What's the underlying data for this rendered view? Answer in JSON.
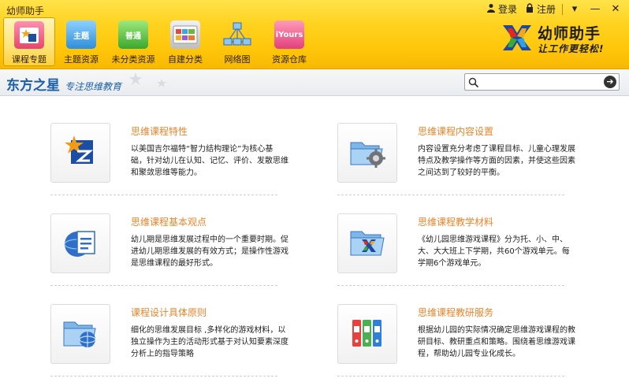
{
  "window": {
    "title": "幼师助手",
    "login": "登录",
    "register": "注册",
    "controls": {
      "menu": "▾",
      "minimize": "—",
      "close": "✕"
    }
  },
  "toolbar": {
    "items": [
      {
        "id": "topic",
        "label": "课程专题",
        "badge": "",
        "active": true
      },
      {
        "id": "theme",
        "label": "主题资源",
        "badge": "主题",
        "active": false
      },
      {
        "id": "general",
        "label": "未分类资源",
        "badge": "普通",
        "active": false
      },
      {
        "id": "custom",
        "label": "自建分类",
        "badge": "",
        "active": false
      },
      {
        "id": "net",
        "label": "网络图",
        "badge": "",
        "active": false
      },
      {
        "id": "iyours",
        "label": "资源仓库",
        "badge": "iYours",
        "active": false
      }
    ]
  },
  "logo": {
    "name": "幼师助手",
    "slogan": "让工作更轻松!"
  },
  "subbar": {
    "brand": "东方之星",
    "brand_tagline": "专注思维教育",
    "search_placeholder": "",
    "search_go": "➔"
  },
  "cards": [
    {
      "id": "c1",
      "title": "思维课程特性",
      "desc": "以美国吉尔福特“智力结构理论”为核心基础，针对幼儿在认知、记忆、评价、发散思维和聚敛思维等能力。",
      "icon": "star-logo-icon"
    },
    {
      "id": "c2",
      "title": "思维课程内容设置",
      "desc": "内容设置充分考虑了课程目标、儿童心理发展特点及教学操作等方面的因素，并使这些因素之间达到了较好的平衡。",
      "icon": "folder-gear-icon"
    },
    {
      "id": "c3",
      "title": "思维课程基本观点",
      "desc": "幼儿期是思维发展过程中的一个重要时期。促进幼儿期思维发展的有效方式；是操作性游戏是思维课程的最好形式。",
      "icon": "document-globe-icon"
    },
    {
      "id": "c4",
      "title": "思维课程教学材料",
      "desc": "《幼儿园思维游戏课程》分为托、小、中、大、大大班上下学期，共60个游戏单元。每学期6个游戏单元。",
      "icon": "folder-x-icon"
    },
    {
      "id": "c5",
      "title": "课程设计具体原则",
      "desc": "细化的思维发展目标 ,多样化的游戏材料，以独立操作为主的活动形式基于对认知要素深度分析上的指导策略",
      "icon": "folder-globe-icon"
    },
    {
      "id": "c6",
      "title": "思维课程教研服务",
      "desc": "根据幼儿园的实际情况确定思维游戏课程的教研目标、教研重点和策略。围绕着思维游戏课程，帮助幼儿园专业化成长。",
      "icon": "binders-icon"
    }
  ]
}
